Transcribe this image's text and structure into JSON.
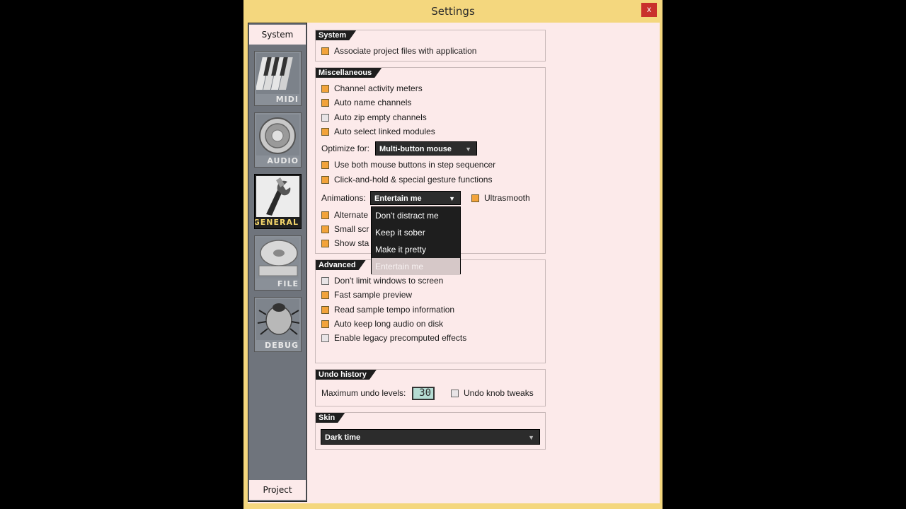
{
  "window": {
    "title": "Settings",
    "close_label": "x"
  },
  "sidebar": {
    "top_tab": "System",
    "bottom_tab": "Project",
    "items": [
      {
        "label": "MIDI",
        "icon": "piano-keys-icon"
      },
      {
        "label": "AUDIO",
        "icon": "speaker-icon"
      },
      {
        "label": "GENERAL",
        "icon": "wrench-icon",
        "active": true
      },
      {
        "label": "FILE",
        "icon": "disk-icon"
      },
      {
        "label": "DEBUG",
        "icon": "bug-icon"
      }
    ]
  },
  "system": {
    "header": "System",
    "associate": "Associate project files with application"
  },
  "misc": {
    "header": "Miscellaneous",
    "channel_meters": "Channel activity meters",
    "auto_name": "Auto name channels",
    "auto_zip": "Auto zip empty channels",
    "auto_select": "Auto select linked modules",
    "optimize_label": "Optimize for:",
    "optimize_value": "Multi-button mouse",
    "both_buttons": "Use both mouse buttons in step sequencer",
    "click_hold": "Click-and-hold & special gesture functions",
    "animations_label": "Animations:",
    "animations_value": "Entertain me",
    "ultrasmooth": "Ultrasmooth",
    "alternate": "Alternate",
    "small_scr": "Small scr",
    "show_sta": "Show sta"
  },
  "dropdown": {
    "options": [
      "Don't distract me",
      "Keep it sober",
      "Make it pretty",
      "Entertain me"
    ],
    "selected": "Entertain me"
  },
  "advanced": {
    "header": "Advanced",
    "dont_limit": "Don't limit windows to screen",
    "fast_preview": "Fast sample preview",
    "read_tempo": "Read sample tempo information",
    "auto_keep": "Auto keep long audio on disk",
    "legacy": "Enable legacy precomputed effects"
  },
  "undo": {
    "header": "Undo history",
    "max_label": "Maximum undo levels:",
    "max_value": "30",
    "knob_tweaks": "Undo knob tweaks"
  },
  "skin": {
    "header": "Skin",
    "value": "Dark time"
  },
  "colors": {
    "window_frame": "#f4d77e",
    "client_bg": "#fceaea",
    "checkbox_on": "#f2a33a",
    "active_label": "#f3d56a"
  }
}
